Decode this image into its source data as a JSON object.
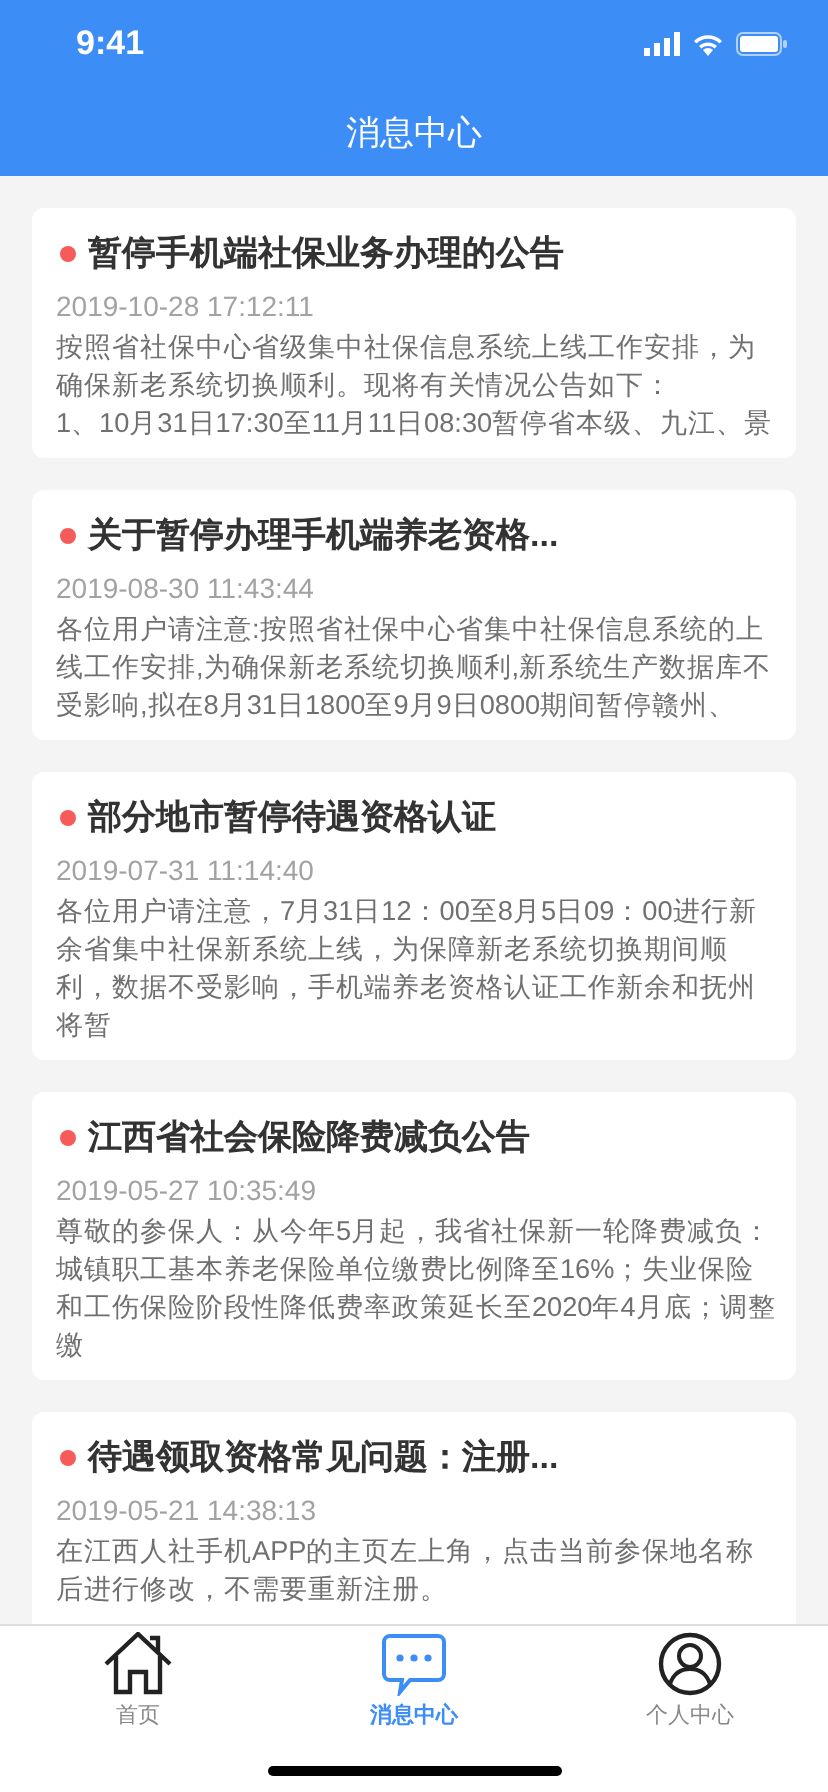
{
  "status_bar": {
    "time": "9:41"
  },
  "header": {
    "title": "消息中心"
  },
  "messages": [
    {
      "title": "暂停手机端社保业务办理的公告",
      "unread": true,
      "date": "2019-10-28 17:12:11",
      "body": "按照省社保中心省级集中社保信息系统上线工作安排，为确保新老系统切换顺利。现将有关情况公告如下：\n1、10月31日17:30至11月11日08:30暂停省本级、九江、景"
    },
    {
      "title": "关于暂停办理手机端养老资格...",
      "unread": true,
      "date": "2019-08-30 11:43:44",
      "body": "各位用户请注意:按照省社保中心省集中社保信息系统的上线工作安排,为确保新老系统切换顺利,新系统生产数据库不受影响,拟在8月31日1800至9月9日0800期间暂停赣州、"
    },
    {
      "title": "部分地市暂停待遇资格认证",
      "unread": true,
      "date": "2019-07-31 11:14:40",
      "body": "各位用户请注意，7月31日12：00至8月5日09：00进行新余省集中社保新系统上线，为保障新老系统切换期间顺利，数据不受影响，手机端养老资格认证工作新余和抚州将暂"
    },
    {
      "title": "江西省社会保险降费减负公告",
      "unread": true,
      "date": "2019-05-27 10:35:49",
      "body": "尊敬的参保人：从今年5月起，我省社保新一轮降费减负：城镇职工基本养老保险单位缴费比例降至16%；失业保险和工伤保险阶段性降低费率政策延长至2020年4月底；调整缴"
    },
    {
      "title": "待遇领取资格常见问题：注册...",
      "unread": true,
      "date": "2019-05-21 14:38:13",
      "body": "在江西人社手机APP的主页左上角，点击当前参保地名称后进行修改，不需要重新注册。"
    }
  ],
  "tabs": [
    {
      "kind": "home",
      "label": "首页",
      "selected": false
    },
    {
      "kind": "messages",
      "label": "消息中心",
      "selected": true
    },
    {
      "kind": "profile",
      "label": "个人中心",
      "selected": false
    }
  ]
}
